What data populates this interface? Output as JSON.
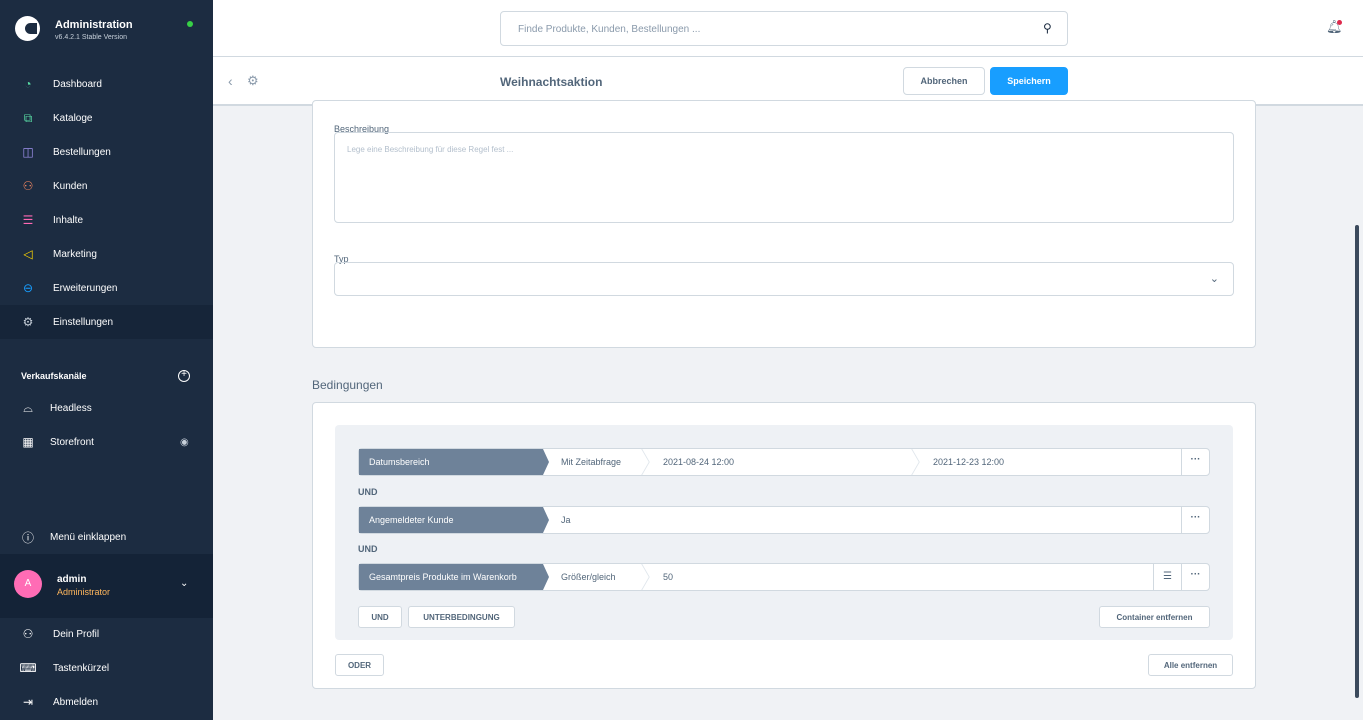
{
  "brand": {
    "title": "Administration",
    "version": "v6.4.2.1 Stable Version"
  },
  "nav": [
    {
      "label": "Dashboard",
      "icon": "dashboard-icon",
      "color": "#57d9a3",
      "glyph": "◔"
    },
    {
      "label": "Kataloge",
      "icon": "catalog-icon",
      "color": "#57d9a3",
      "glyph": "⧉"
    },
    {
      "label": "Bestellungen",
      "icon": "shopping-bag-icon",
      "color": "#a092f0",
      "glyph": "◫"
    },
    {
      "label": "Kunden",
      "icon": "customers-icon",
      "color": "#f88962",
      "glyph": "⚇"
    },
    {
      "label": "Inhalte",
      "icon": "content-icon",
      "color": "#ff68b4",
      "glyph": "☰"
    },
    {
      "label": "Marketing",
      "icon": "megaphone-icon",
      "color": "#ffd700",
      "glyph": "◁"
    },
    {
      "label": "Erweiterungen",
      "icon": "plugin-icon",
      "color": "#189eff",
      "glyph": "⊖"
    },
    {
      "label": "Einstellungen",
      "icon": "settings-icon",
      "color": "#c7d0da",
      "glyph": "⚙"
    }
  ],
  "sales_channels": {
    "title": "Verkaufskanäle",
    "items": [
      {
        "label": "Headless",
        "icon": "basket-icon",
        "glyph": "⌓"
      },
      {
        "label": "Storefront",
        "icon": "storefront-icon",
        "glyph": "▦"
      }
    ]
  },
  "collapse_label": "Menü einklappen",
  "user": {
    "initial": "A",
    "name": "admin",
    "role": "Administrator"
  },
  "user_menu": [
    {
      "label": "Dein Profil",
      "icon": "profile-icon",
      "glyph": "⚇"
    },
    {
      "label": "Tastenkürzel",
      "icon": "keyboard-icon",
      "glyph": "⌨"
    },
    {
      "label": "Abmelden",
      "icon": "logout-icon",
      "glyph": "⇥"
    }
  ],
  "search": {
    "placeholder": "Finde Produkte, Kunden, Bestellungen ..."
  },
  "smartbar": {
    "title": "Weihnachtsaktion",
    "cancel_label": "Abbrechen",
    "save_label": "Speichern"
  },
  "form": {
    "description_label": "Beschreibung",
    "description_placeholder": "Lege eine Beschreibung für diese Regel fest ...",
    "type_label": "Typ",
    "type_value": ""
  },
  "conditions": {
    "heading": "Bedingungen",
    "rows": [
      {
        "field": "Datumsbereich",
        "operator": "Mit Zeitabfrage",
        "value1": "2021-08-24 12:00",
        "value2": "2021-12-23 12:00"
      },
      {
        "field": "Angemeldeter Kunde",
        "value1": "Ja"
      },
      {
        "field": "Gesamtpreis Produkte im Warenkorb",
        "operator": "Größer/gleich",
        "value1": "50"
      }
    ],
    "and_label": "UND",
    "and_button": "UND",
    "subcondition_button": "UNTERBEDINGUNG",
    "remove_container_button": "Container entfernen",
    "or_button": "ODER",
    "remove_all_button": "Alle entfernen"
  }
}
